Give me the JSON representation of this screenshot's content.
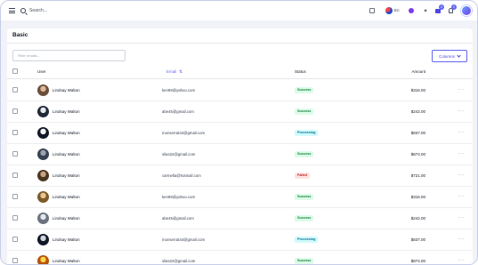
{
  "topbar": {
    "search_placeholder": "Search...",
    "language": "En",
    "notification_count_1": "2",
    "notification_count_2": "2"
  },
  "card": {
    "title": "Basic",
    "filter_placeholder": "Filter emails...",
    "columns_label": "Columns"
  },
  "table": {
    "headers": {
      "user": "User",
      "email": "Email",
      "status": "Status",
      "amount": "Amount"
    },
    "rows": [
      {
        "user": "Lindsay Walton",
        "email": "ken99@yahoo.com",
        "status": "Success",
        "amount": "$316.00",
        "avatar_colors": [
          "#6b4f3a",
          "#d9b99b"
        ]
      },
      {
        "user": "Lindsay Walton",
        "email": "abe45@gmail.com",
        "status": "Success",
        "amount": "$242.00",
        "avatar_colors": [
          "#1f2937",
          "#e5e7eb"
        ]
      },
      {
        "user": "Lindsay Walton",
        "email": "monserrat44@gmail.com",
        "status": "Processing",
        "amount": "$837.00",
        "avatar_colors": [
          "#111827",
          "#f3f4f6"
        ]
      },
      {
        "user": "Lindsay Walton",
        "email": "silas22@gmail.com",
        "status": "Success",
        "amount": "$874.00",
        "avatar_colors": [
          "#374151",
          "#9ca3af"
        ]
      },
      {
        "user": "Lindsay Walton",
        "email": "carmella@hotmail.com",
        "status": "Failed",
        "amount": "$721.00",
        "avatar_colors": [
          "#4b3621",
          "#c4a484"
        ]
      },
      {
        "user": "Lindsay Walton",
        "email": "ken99@yahoo.com",
        "status": "Success",
        "amount": "$316.00",
        "avatar_colors": [
          "#7c5a2a",
          "#e7c68b"
        ]
      },
      {
        "user": "Lindsay Walton",
        "email": "abe45@gmail.com",
        "status": "Success",
        "amount": "$242.00",
        "avatar_colors": [
          "#6b7280",
          "#e5e7eb"
        ]
      },
      {
        "user": "Lindsay Walton",
        "email": "monserrat44@gmail.com",
        "status": "Processing",
        "amount": "$837.00",
        "avatar_colors": [
          "#111827",
          "#d1d5db"
        ]
      },
      {
        "user": "Lindsay Walton",
        "email": "silas22@gmail.com",
        "status": "Success",
        "amount": "$874.00",
        "avatar_colors": [
          "#b45309",
          "#fcd34d"
        ]
      }
    ]
  },
  "status_colors": {
    "Success": {
      "bg": "#dcfce7",
      "fg": "#15803d"
    },
    "Processing": {
      "bg": "#cffafe",
      "fg": "#0e7490"
    },
    "Failed": {
      "bg": "#fee2e2",
      "fg": "#b91c1c"
    }
  },
  "accent_color": "#6366f1"
}
